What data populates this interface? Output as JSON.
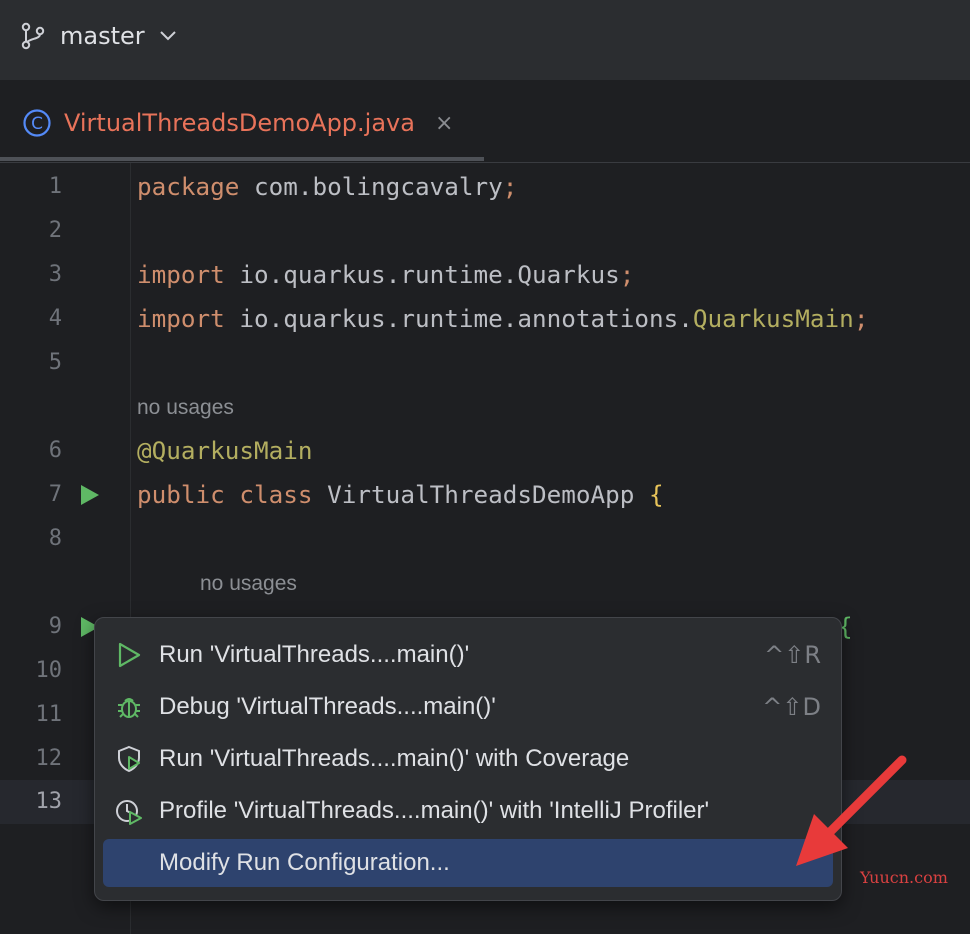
{
  "toolbar": {
    "branch": "master"
  },
  "tab": {
    "file_name": "VirtualThreadsDemoApp.java",
    "close": "×",
    "icon_letter": "C"
  },
  "editor": {
    "lines": [
      {
        "n": "1"
      },
      {
        "n": "2"
      },
      {
        "n": "3"
      },
      {
        "n": "4"
      },
      {
        "n": "5"
      },
      {
        "n": "6"
      },
      {
        "n": "7"
      },
      {
        "n": "8"
      },
      {
        "n": "9"
      },
      {
        "n": "10"
      },
      {
        "n": "11"
      },
      {
        "n": "12"
      },
      {
        "n": "13"
      }
    ],
    "code": {
      "l1_kw": "package",
      "l1_rest": " com.bolingcavalry",
      "l1_end": ";",
      "l3_kw": "import",
      "l3_rest": " io.quarkus.runtime.Quarkus",
      "l3_end": ";",
      "l4_kw": "import",
      "l4_rest": " io.quarkus.runtime.annotations.",
      "l4_ann": "QuarkusMain",
      "l4_end": ";",
      "l6_ann": "@QuarkusMain",
      "l7_kw": "public class",
      "l7_rest": " VirtualThreadsDemoApp ",
      "l7_brace": "{",
      "l9_brace": "{"
    },
    "hints": {
      "hint1": "no usages",
      "hint2": "no usages"
    }
  },
  "popup": {
    "items": [
      {
        "label": "Run 'VirtualThreads....main()'",
        "shortcut": "^⇧R",
        "icon": "run-icon"
      },
      {
        "label": "Debug 'VirtualThreads....main()'",
        "shortcut": "^⇧D",
        "icon": "debug-icon"
      },
      {
        "label": "Run 'VirtualThreads....main()' with Coverage",
        "shortcut": "",
        "icon": "coverage-icon"
      },
      {
        "label": "Profile 'VirtualThreads....main()' with 'IntelliJ Profiler'",
        "shortcut": "",
        "icon": "profiler-icon"
      },
      {
        "label": "Modify Run Configuration...",
        "shortcut": "",
        "icon": ""
      }
    ],
    "selected_index": 4
  },
  "watermark": "Yuucn.com",
  "colors": {
    "accent_selected": "#2e436e",
    "run_green": "#5fb865",
    "tab_text": "#e8735a",
    "keyword": "#cf8e6d",
    "annotation": "#b3ae60"
  }
}
